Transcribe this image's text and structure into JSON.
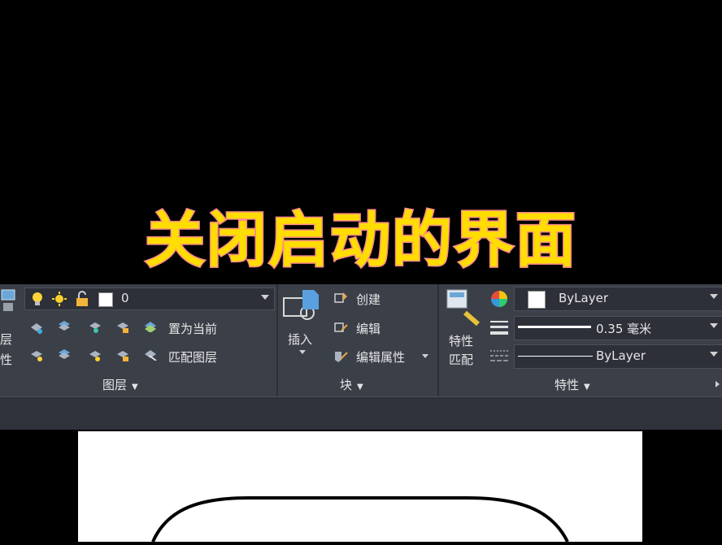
{
  "caption": "关闭启动的界面",
  "layers": {
    "current_layer": "0",
    "left_label_top": "层",
    "left_label_bottom": "性",
    "set_current": "置为当前",
    "match_layer": "匹配图层",
    "panel_title": "图层"
  },
  "block": {
    "insert": "插入",
    "create": "创建",
    "edit": "编辑",
    "edit_attributes": "编辑属性",
    "panel_title": "块"
  },
  "properties": {
    "match_top": "特性",
    "match_bottom": "匹配",
    "color_value": "ByLayer",
    "lineweight_value": "0.35 毫米",
    "linetype_value": "ByLayer",
    "panel_title": "特性"
  },
  "colors": {
    "ribbon_bg": "#3b3f48",
    "caption_fill": "#ffdd00",
    "caption_stroke": "#ff8a8a"
  }
}
